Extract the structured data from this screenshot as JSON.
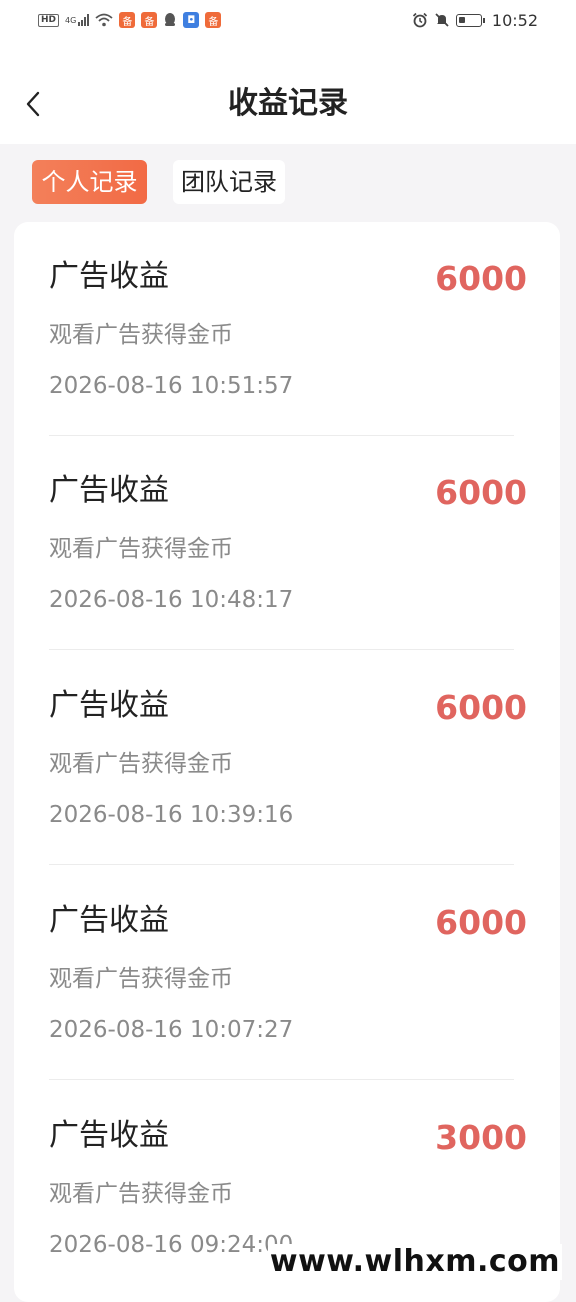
{
  "status_bar": {
    "hd_label": "HD",
    "network_label": "4G",
    "time": "10:52",
    "app_icon_glyph": "备"
  },
  "header": {
    "title": "收益记录",
    "back_icon": "chevron-left-icon"
  },
  "tabs": [
    {
      "label": "个人记录",
      "active": true
    },
    {
      "label": "团队记录",
      "active": false
    }
  ],
  "records": [
    {
      "title": "广告收益",
      "amount": "6000",
      "desc": "观看广告获得金币",
      "time": "2026-08-16 10:51:57"
    },
    {
      "title": "广告收益",
      "amount": "6000",
      "desc": "观看广告获得金币",
      "time": "2026-08-16 10:48:17"
    },
    {
      "title": "广告收益",
      "amount": "6000",
      "desc": "观看广告获得金币",
      "time": "2026-08-16 10:39:16"
    },
    {
      "title": "广告收益",
      "amount": "6000",
      "desc": "观看广告获得金币",
      "time": "2026-08-16 10:07:27"
    },
    {
      "title": "广告收益",
      "amount": "3000",
      "desc": "观看广告获得金币",
      "time": "2026-08-16 09:24:00"
    }
  ],
  "watermark": "www.wlhxm.com",
  "colors": {
    "accent": "#f26a45",
    "amount": "#e0655f",
    "background": "#f5f4f6"
  }
}
